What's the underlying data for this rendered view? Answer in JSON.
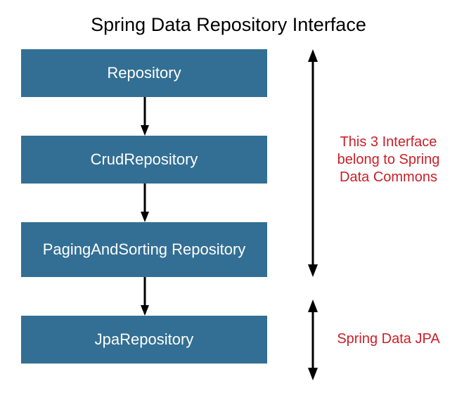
{
  "title": "Spring Data Repository Interface",
  "boxes": {
    "repository": "Repository",
    "crud": "CrudRepository",
    "paging": "PagingAndSorting Repository",
    "jpa": "JpaRepository"
  },
  "notes": {
    "commons": "This 3 Interface belong to Spring Data Commons",
    "jpa": "Spring Data JPA"
  },
  "colors": {
    "box_bg": "#336f94",
    "box_text": "#ffffff",
    "note_text": "#c92028",
    "arrow": "#000000"
  }
}
